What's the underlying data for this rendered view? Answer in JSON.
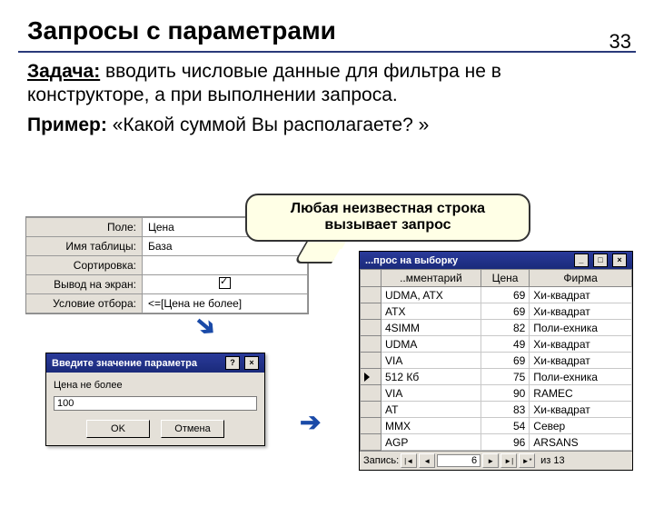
{
  "page_number": "33",
  "title": "Запросы с параметрами",
  "task_label": "Задача:",
  "task_text": " вводить числовые данные для фильтра не в конструкторе, а при выполнении запроса.",
  "example_label": "Пример:",
  "example_text": " «Какой суммой Вы располагаете? »",
  "callout_line1": "Любая неизвестная строка",
  "callout_line2": "вызывает запрос",
  "designer": {
    "rows": [
      {
        "label": "Поле:",
        "value": "Цена"
      },
      {
        "label": "Имя таблицы:",
        "value": "База"
      },
      {
        "label": "Сортировка:",
        "value": ""
      },
      {
        "label": "Вывод на экран:",
        "value": "[check]"
      },
      {
        "label": "Условие отбора:",
        "value": "<=[Цена не более]"
      }
    ]
  },
  "dialog": {
    "title": "Введите значение параметра",
    "prompt": "Цена не более",
    "value": "100",
    "ok": "OK",
    "cancel": "Отмена"
  },
  "results": {
    "title": "...прос на выборку",
    "columns": [
      "..мментарий",
      "Цена",
      "Фирма"
    ],
    "rows": [
      [
        "UDMA, ATX",
        "69",
        "Хи-квадрат"
      ],
      [
        "ATX",
        "69",
        "Хи-квадрат"
      ],
      [
        "4SIMM",
        "82",
        "Поли-ехника"
      ],
      [
        "UDMA",
        "49",
        "Хи-квадрат"
      ],
      [
        "VIA",
        "69",
        "Хи-квадрат"
      ],
      [
        "512 Кб",
        "75",
        "Поли-ехника"
      ],
      [
        "VIA",
        "90",
        "RAMEC"
      ],
      [
        "AT",
        "83",
        "Хи-квадрат"
      ],
      [
        "MMX",
        "54",
        "Север"
      ],
      [
        "AGP",
        "96",
        "ARSANS"
      ]
    ],
    "selected_row_index": 5,
    "nav_label": "Запись:",
    "nav_current": "6",
    "nav_total_label": "из 13"
  }
}
